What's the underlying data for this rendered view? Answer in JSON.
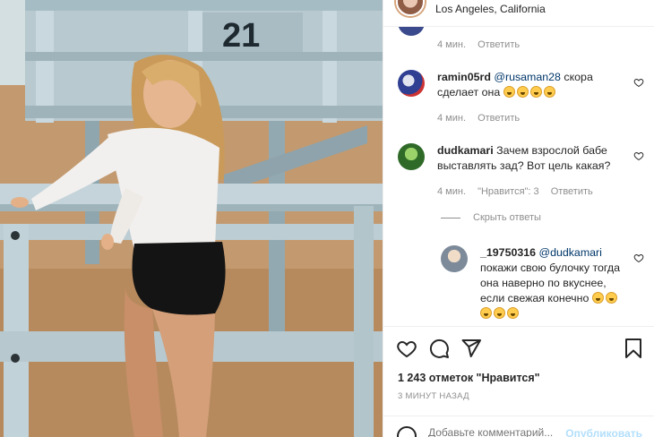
{
  "post": {
    "location": "Los Angeles, California",
    "tower_number": "21"
  },
  "comments": [
    {
      "meta_time": "4 мин.",
      "meta_reply": "Ответить"
    },
    {
      "username": "ramin05rd",
      "mention": "@rusaman28",
      "text": "скора сделает она",
      "emoji_count": 4,
      "meta_time": "4 мин.",
      "meta_reply": "Ответить"
    },
    {
      "username": "dudkamari",
      "text": "Зачем взрослой бабе выставлять зад? Вот цель какая?",
      "meta_time": "4 мин.",
      "meta_likes": "\"Нравится\": 3",
      "meta_reply": "Ответить"
    }
  ],
  "hide_replies": "Скрыть ответы",
  "reply": {
    "username": "_19750316",
    "mention": "@dudkamari",
    "text": "покажи свою булочку тогда она наверно по вкуснее, если свежая конечно",
    "emoji_count": 5
  },
  "actions": {
    "like_icon": "heart-icon",
    "comment_icon": "comment-bubble-icon",
    "share_icon": "paper-plane-icon",
    "save_icon": "bookmark-icon"
  },
  "likes_text": "1 243 отметок \"Нравится\"",
  "time_ago": "3 минут назад",
  "add_comment": {
    "placeholder": "Добавьте комментарий...",
    "publish_label": "Опубликовать"
  },
  "colors": {
    "link": "#00376b",
    "secondary_text": "#8e8e8e",
    "publish_disabled": "#b2dffc"
  }
}
